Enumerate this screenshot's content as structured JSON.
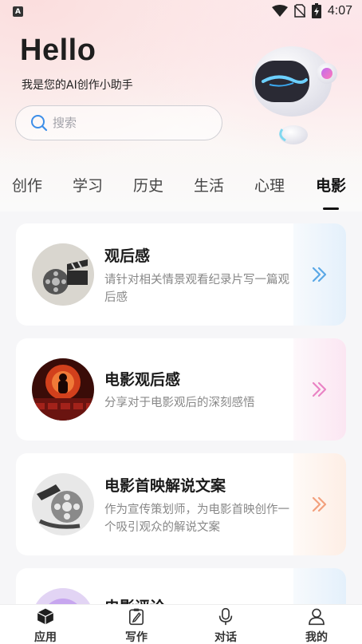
{
  "status_bar": {
    "app_icon": "A",
    "time": "4:07",
    "icons": [
      "wifi-icon",
      "no-sim-icon",
      "battery-icon"
    ]
  },
  "header": {
    "greeting": "Hello",
    "subtitle": "我是您的AI创作小助手",
    "mascot": "robot-mascot"
  },
  "search": {
    "placeholder": "搜索",
    "value": ""
  },
  "tabs": [
    {
      "label": "创作",
      "active": false
    },
    {
      "label": "学习",
      "active": false
    },
    {
      "label": "历史",
      "active": false
    },
    {
      "label": "生活",
      "active": false
    },
    {
      "label": "心理",
      "active": false
    },
    {
      "label": "电影",
      "active": true
    }
  ],
  "cards": [
    {
      "title": "观后感",
      "description": "请针对相关情景观看纪录片写一篇观后感",
      "thumb": "film-clapper-reel",
      "arrow_color": "#5aa8e6"
    },
    {
      "title": "电影观后感",
      "description": "分享对于电影观后的深刻感悟",
      "thumb": "red-cinema-seats",
      "arrow_color": "#e983c4"
    },
    {
      "title": "电影首映解说文案",
      "description": "作为宣传策划师，为电影首映创作一个吸引观众的解说文案",
      "thumb": "film-reel-strip",
      "arrow_color": "#f2a07d"
    },
    {
      "title": "电影评论",
      "description": "",
      "thumb": "purple-headphones",
      "arrow_color": "#5aa8e6"
    }
  ],
  "bottom_nav": [
    {
      "label": "应用",
      "icon": "cube-icon",
      "active": true
    },
    {
      "label": "写作",
      "icon": "pen-icon",
      "active": false
    },
    {
      "label": "对话",
      "icon": "microphone-icon",
      "active": false
    },
    {
      "label": "我的",
      "icon": "user-icon",
      "active": false
    }
  ]
}
